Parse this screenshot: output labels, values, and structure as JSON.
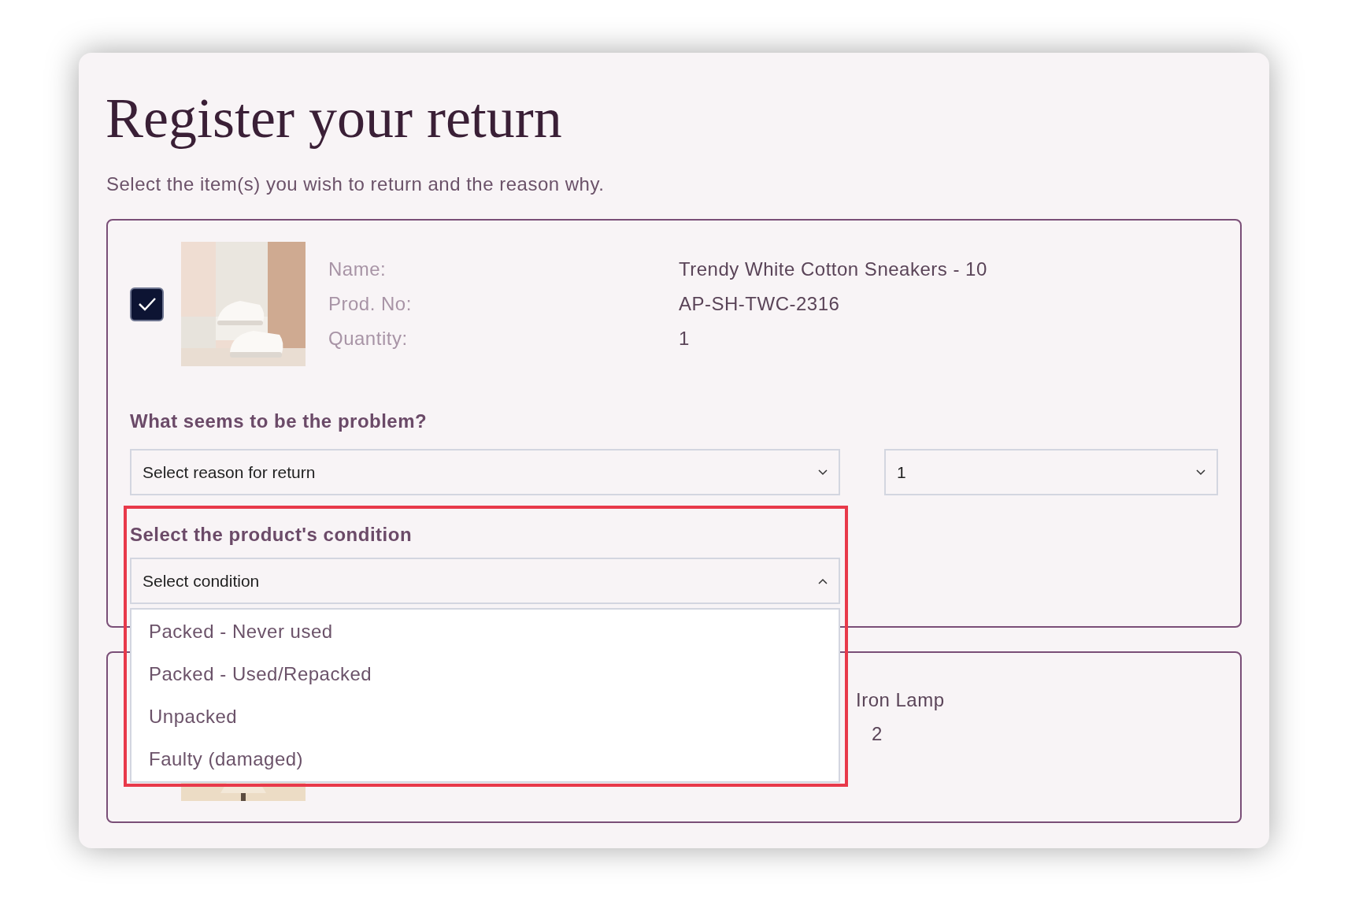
{
  "title": "Register your return",
  "subtitle": "Select the item(s) you wish to return and the reason why.",
  "return_item": {
    "checked": true,
    "picture": {
      "kind": "picture"
    },
    "fields": [
      {
        "label": "Name:",
        "value": "Trendy White Cotton Sneakers - 10"
      },
      {
        "label": "Prod. No:",
        "value": "AP-SH-TWC-2316"
      },
      {
        "label": "Quantity:",
        "value": "1"
      }
    ],
    "problem": {
      "heading": "What seems to be the problem?",
      "reason_placeholder": "Select reason for return",
      "quantity": "1"
    },
    "condition": {
      "heading": "Select the product's condition",
      "placeholder": "Select condition",
      "expanded": true,
      "highlighted": true,
      "options": [
        "Packed - Never used",
        "Packed - Used/Repacked",
        "Unpacked",
        "Faulty (damaged)"
      ]
    }
  },
  "second_item": {
    "picture": {
      "kind": "picture"
    },
    "values": [
      "Iron Lamp",
      "2"
    ]
  }
}
